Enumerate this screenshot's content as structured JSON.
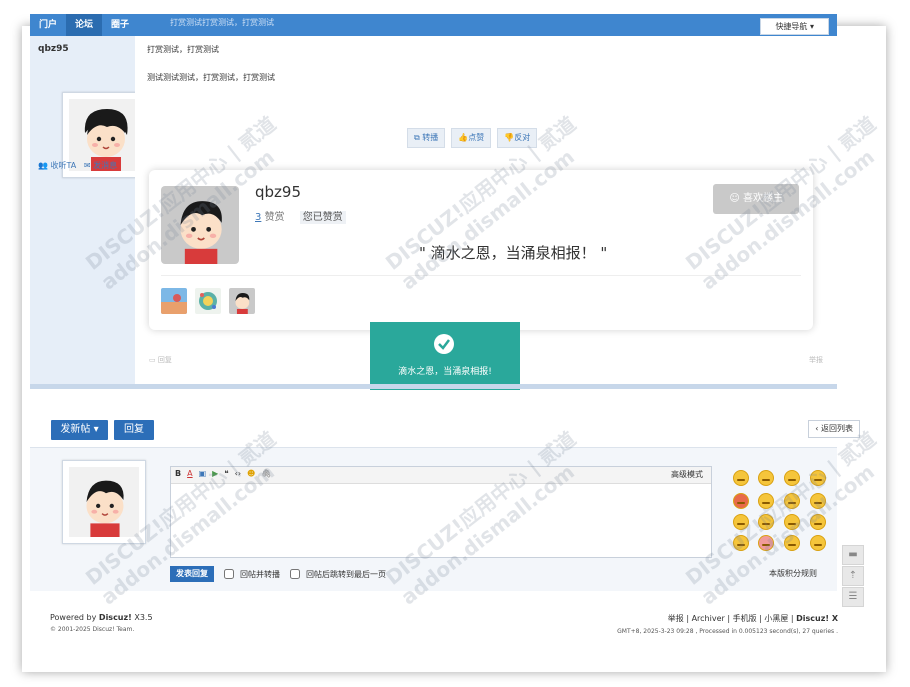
{
  "topbar": {
    "nav": [
      "门户",
      "论坛",
      "圈子"
    ],
    "active_index": 1,
    "breadcrumb": "打赏测试打赏测试，打赏测试",
    "quicknav": "快捷导航 ▾"
  },
  "author": {
    "name": "qbz95",
    "follow": "收听TA",
    "message": "发消息"
  },
  "post": {
    "title": "打赏测试，打赏测试",
    "body": "测试测试测试，打赏测试，打赏测试",
    "actions": [
      "转播",
      "点赞",
      "反对"
    ]
  },
  "reward_card": {
    "name": "qbz95",
    "count": "3",
    "count_label": "赞赏",
    "given": "您已赞赏",
    "like_button": "喜欢楼主",
    "quote": "\" 滴水之恩，当涌泉相报！ \""
  },
  "toast": {
    "message": "滴水之恩，当涌泉相报!"
  },
  "post_footer": {
    "reply": "回复",
    "report": "举报"
  },
  "buttons": {
    "new_post": "发新帖 ▾",
    "reply": "回复",
    "back_list": "‹ 返回列表"
  },
  "editor": {
    "advanced": "高级模式",
    "submit": "发表回复",
    "option1": "回帖并转播",
    "option2": "回帖后跳转到最后一页",
    "rules": "本版积分规则"
  },
  "footer": {
    "powered_prefix": "Powered by ",
    "powered_brand": "Discuz!",
    "powered_version": " X3.5",
    "copyright": "© 2001-2025 Discuz! Team.",
    "links": "举报 | Archiver | 手机版 | 小黑屋 | ",
    "links_brand": "Discuz! X",
    "stats": "GMT+8, 2025-3-23 09:28 , Processed in 0.005123 second(s), 27 queries ."
  },
  "watermark": {
    "line1": "DISCUZ!应用中心 | 贰道",
    "line2": "addon.dismall.com"
  },
  "colors": {
    "brand_blue": "#3f86cf",
    "button_blue": "#2c6eb8",
    "toast_teal": "#2aa89b",
    "side_bg": "#e6eef8"
  },
  "icons": [
    "forward-icon",
    "thumbs-up-icon",
    "thumbs-down-icon",
    "check-icon",
    "follow-icon",
    "mail-icon",
    "float-reply-icon",
    "float-top-icon",
    "float-list-icon"
  ]
}
